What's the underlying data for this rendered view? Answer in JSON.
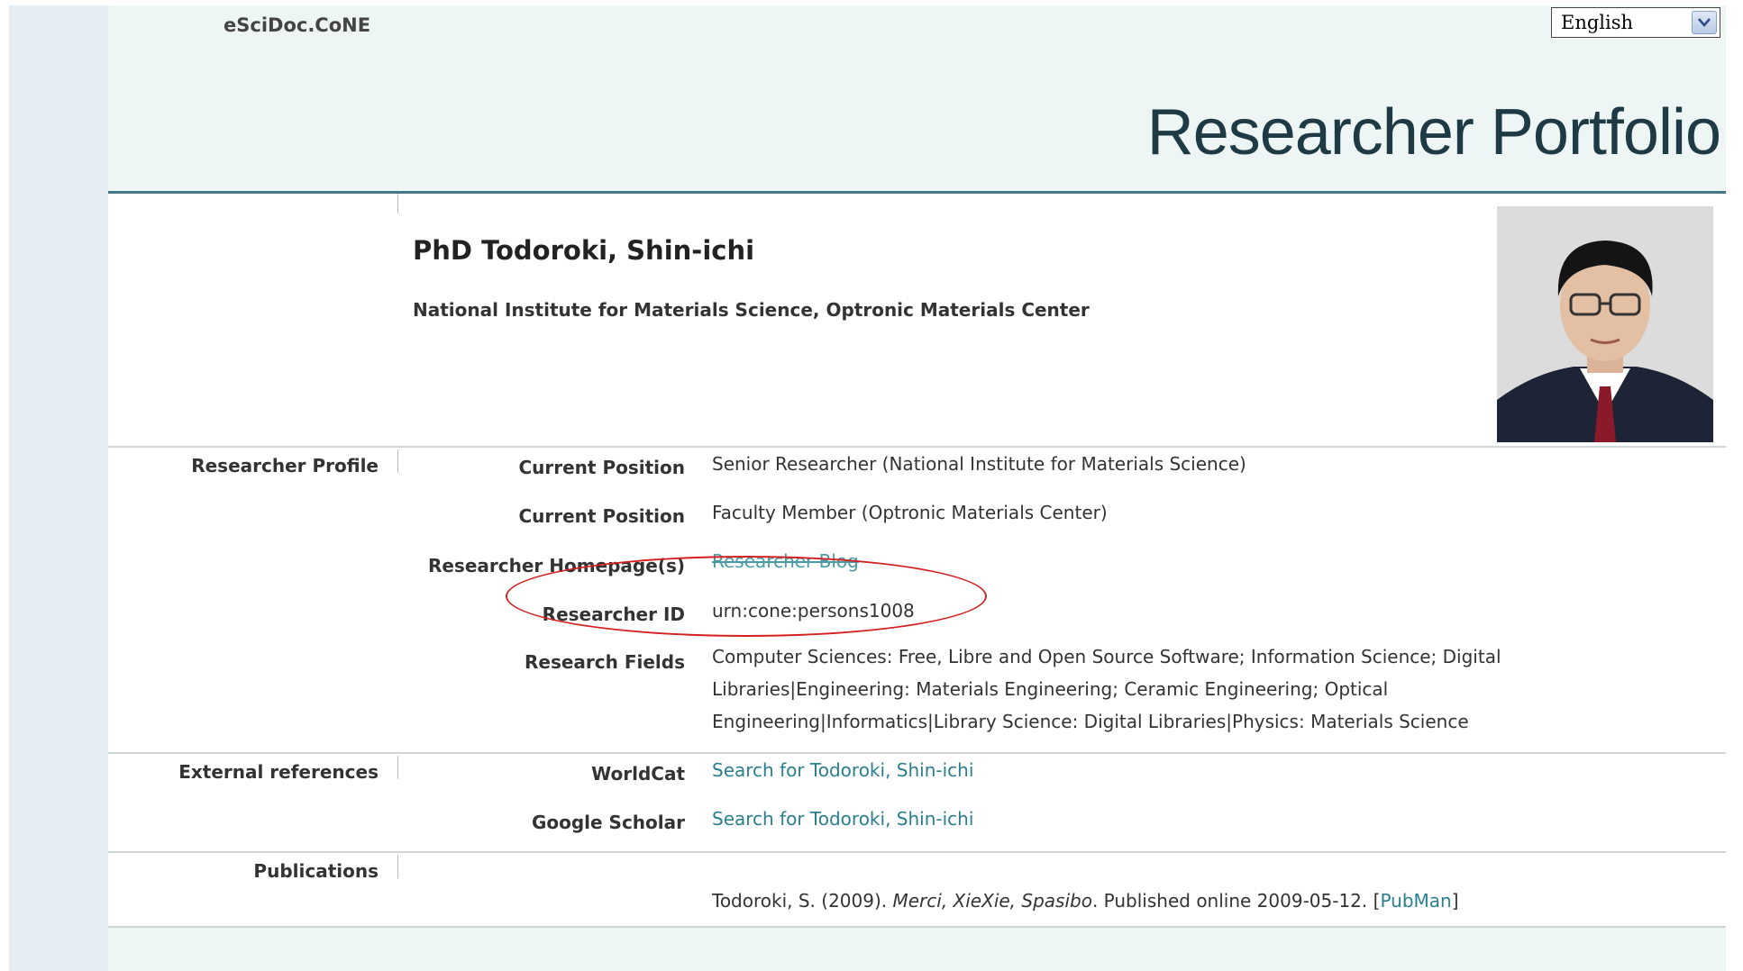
{
  "app": {
    "name": "eSciDoc.CoNE"
  },
  "language": {
    "selected": "English",
    "icon": "chevron-down-icon"
  },
  "header": {
    "title": "Researcher Portfolio"
  },
  "person": {
    "name": "PhD Todoroki, Shin-ichi",
    "organization": "National Institute for Materials Science, Optronic Materials Center",
    "photo_icon": "person-photo"
  },
  "sections": {
    "profile": {
      "label": "Researcher Profile",
      "fields": [
        {
          "label": "Current Position",
          "value": "Senior Researcher (National Institute for Materials Science)"
        },
        {
          "label": "Current Position",
          "value": "Faculty Member (Optronic Materials Center)"
        },
        {
          "label": "Researcher Homepage(s)",
          "value": "Researcher Blog"
        },
        {
          "label": "Researcher ID",
          "value": "urn:cone:persons1008"
        },
        {
          "label": "Research Fields",
          "value": "Computer Sciences: Free, Libre and Open Source Software; Information Science; Digital Libraries|Engineering: Materials Engineering; Ceramic Engineering; Optical Engineering|Informatics|Library Science: Digital Libraries|Physics: Materials Science"
        }
      ]
    },
    "external": {
      "label": "External references",
      "fields": [
        {
          "label": "WorldCat",
          "value": "Search for Todoroki, Shin-ichi"
        },
        {
          "label": "Google Scholar",
          "value": "Search for Todoroki, Shin-ichi"
        }
      ]
    },
    "publications": {
      "label": "Publications",
      "item": {
        "prefix": "Todoroki, S. (2009). ",
        "title": "Merci, XieXie, Spasibo",
        "suffix": ". Published online 2009-05-12.  [",
        "link": "PubMan",
        "close": "]"
      }
    }
  },
  "colors": {
    "accent": "#3d7a86",
    "link": "#2a7f8f",
    "annotation": "#d42020",
    "background": "#edf5f5"
  }
}
